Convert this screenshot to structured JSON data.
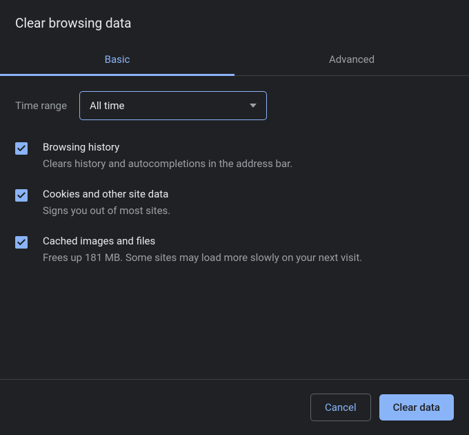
{
  "title": "Clear browsing data",
  "tabs": {
    "basic": "Basic",
    "advanced": "Advanced"
  },
  "timeRange": {
    "label": "Time range",
    "value": "All time"
  },
  "options": [
    {
      "title": "Browsing history",
      "desc": "Clears history and autocompletions in the address bar.",
      "checked": true
    },
    {
      "title": "Cookies and other site data",
      "desc": "Signs you out of most sites.",
      "checked": true
    },
    {
      "title": "Cached images and files",
      "desc": "Frees up 181 MB. Some sites may load more slowly on your next visit.",
      "checked": true
    }
  ],
  "buttons": {
    "cancel": "Cancel",
    "clear": "Clear data"
  }
}
